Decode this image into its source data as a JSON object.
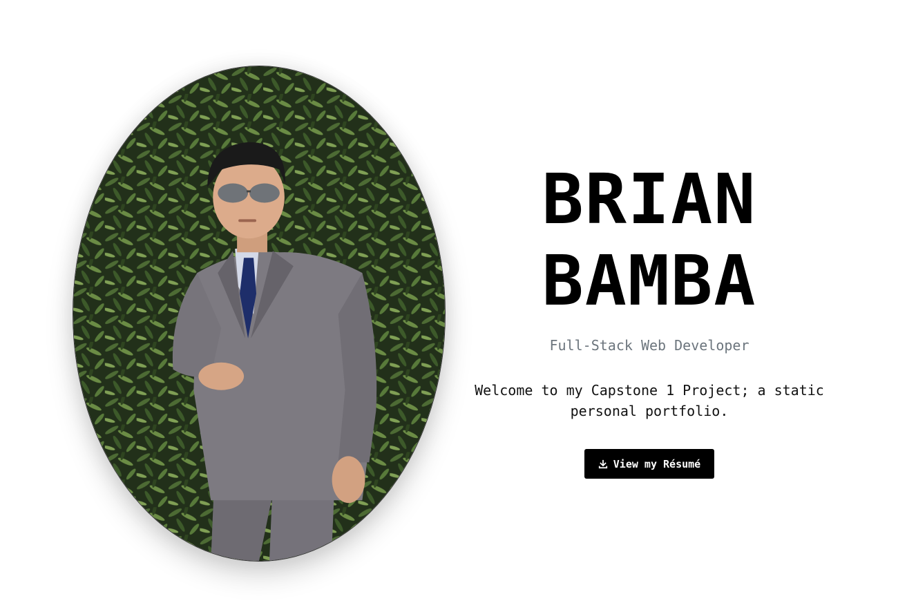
{
  "hero": {
    "name_first": "BRIAN",
    "name_last": "BAMBA",
    "subtitle": "Full-Stack Web Developer",
    "welcome": "Welcome to my Capstone 1 Project; a static personal portfolio.",
    "button_label": "View my Résumé",
    "button_icon": "download-icon"
  },
  "portrait": {
    "alt": "portrait-photo",
    "colors": {
      "foliage_dark": "#1f2a17",
      "foliage_mid": "#3f5a2b",
      "foliage_light": "#6f8f4a",
      "suit": "#7b787e",
      "tie": "#1f2f6b",
      "shirt": "#d7dcea",
      "skin": "#d8a98a",
      "hair": "#1a1a1a"
    }
  }
}
